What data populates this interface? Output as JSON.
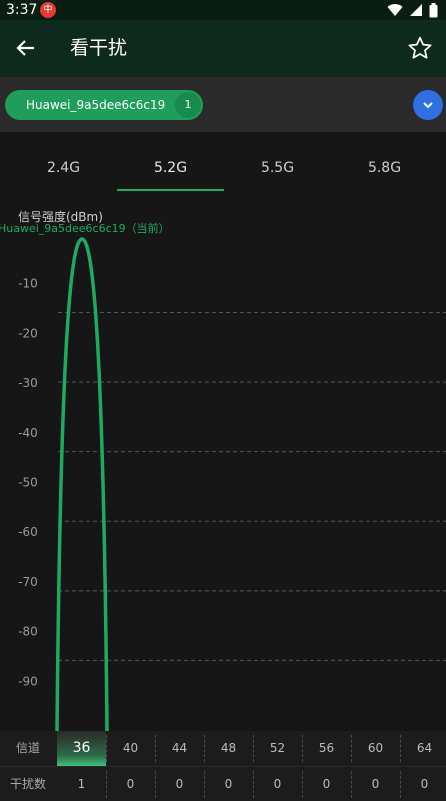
{
  "status": {
    "time": "3:37",
    "notif_glyph": "中"
  },
  "appbar": {
    "title": "看干扰"
  },
  "ap": {
    "name": "Huawei_9a5dee6c6c19",
    "count": "1"
  },
  "tabs": [
    "2.4G",
    "5.2G",
    "5.5G",
    "5.8G"
  ],
  "active_tab": "5.2G",
  "chart": {
    "y_label": "信号强度(dBm)",
    "series_label": "Huawei_9a5dee6c6c19（当前）",
    "y_ticks": [
      "-10",
      "-20",
      "-30",
      "-40",
      "-50",
      "-60",
      "-70",
      "-80",
      "-90"
    ]
  },
  "chart_data": {
    "type": "area",
    "ylabel": "信号强度(dBm)",
    "ylim": [
      -100,
      0
    ],
    "series": [
      {
        "name": "Huawei_9a5dee6c6c19（当前）",
        "channel": 36,
        "peak_dbm": -1
      }
    ],
    "color": "#1faa63"
  },
  "table": {
    "channel_label": "信道",
    "count_label": "干扰数",
    "channels": [
      "36",
      "40",
      "44",
      "48",
      "52",
      "56",
      "60",
      "64"
    ],
    "counts": [
      "1",
      "0",
      "0",
      "0",
      "0",
      "0",
      "0",
      "0"
    ],
    "highlight_channel": "36"
  }
}
